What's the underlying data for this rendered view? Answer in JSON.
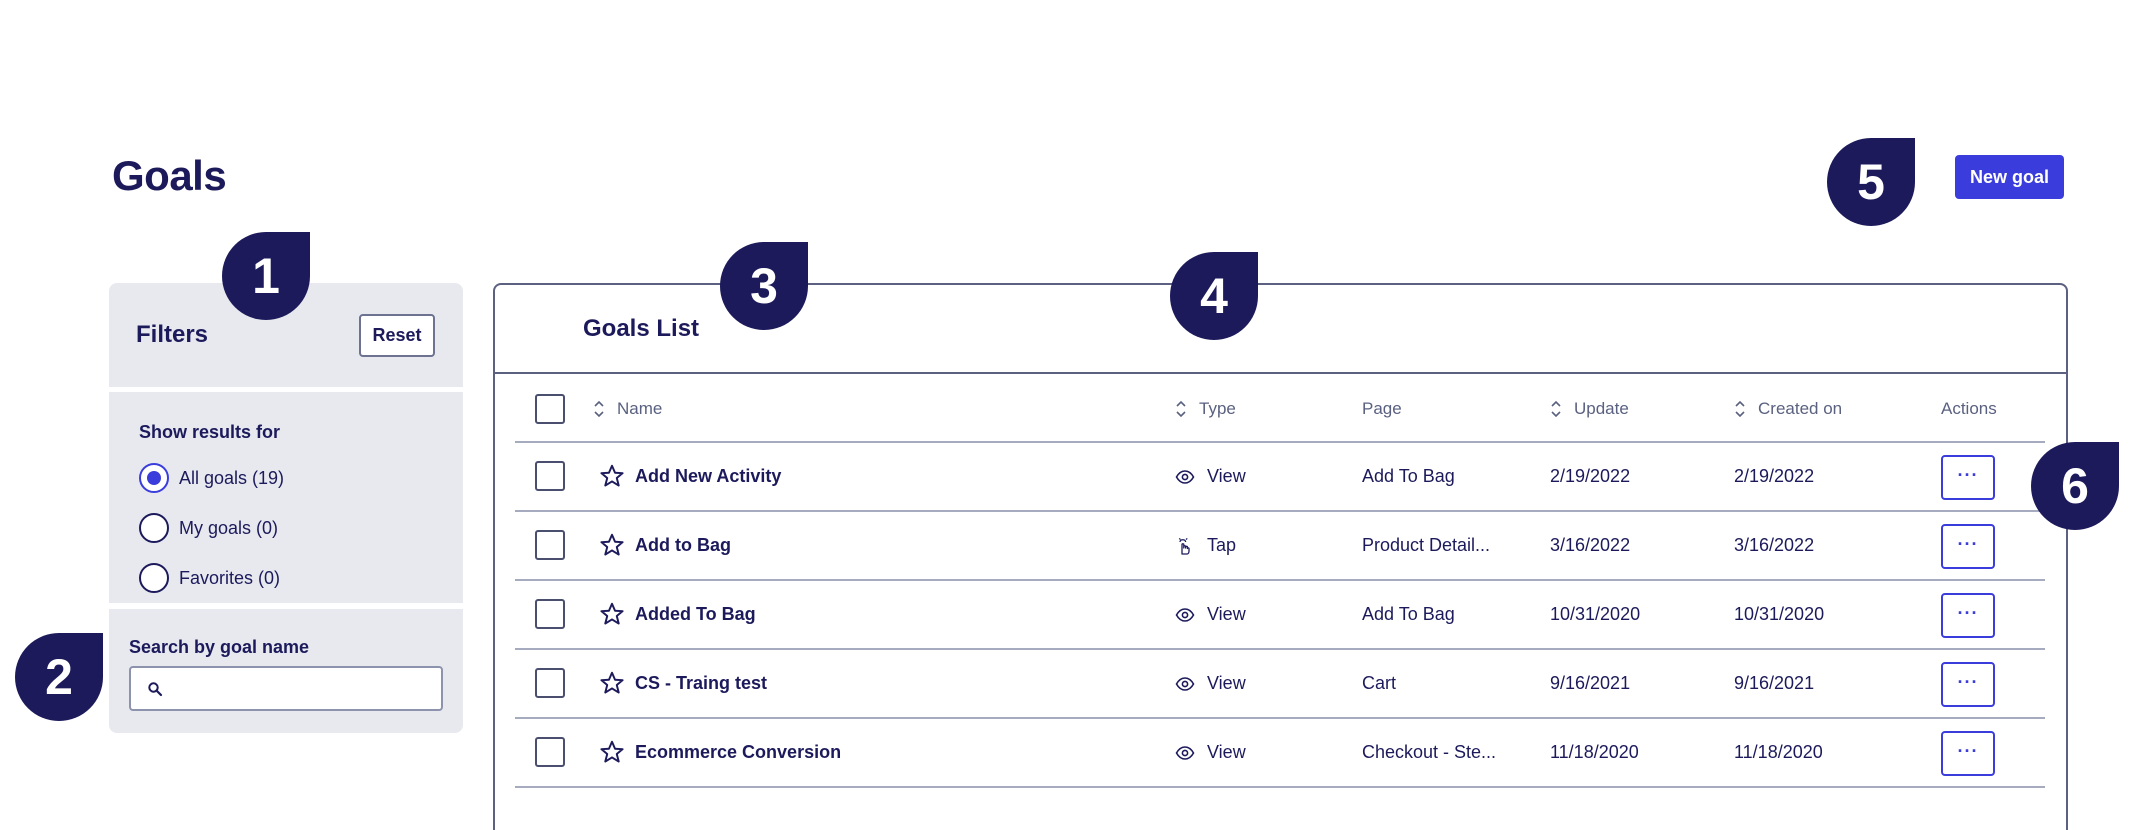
{
  "page": {
    "title": "Goals",
    "new_goal_label": "New goal"
  },
  "filters": {
    "title": "Filters",
    "reset_label": "Reset",
    "show_results_label": "Show results for",
    "options": [
      {
        "label": "All goals (19)",
        "checked": true
      },
      {
        "label": "My goals (0)",
        "checked": false
      },
      {
        "label": "Favorites (0)",
        "checked": false
      }
    ],
    "search_label": "Search by goal name",
    "search_value": ""
  },
  "goals_list": {
    "title": "Goals List",
    "columns": {
      "name": "Name",
      "type": "Type",
      "page": "Page",
      "update": "Update",
      "created": "Created on",
      "actions": "Actions"
    },
    "rows": [
      {
        "name": "Add New Activity",
        "type": "View",
        "type_icon": "eye-icon",
        "page": "Add To Bag",
        "update": "2/19/2022",
        "created": "2/19/2022"
      },
      {
        "name": "Add to Bag",
        "type": "Tap",
        "type_icon": "tap-icon",
        "page": "Product Detail...",
        "update": "3/16/2022",
        "created": "3/16/2022"
      },
      {
        "name": "Added To Bag",
        "type": "View",
        "type_icon": "eye-icon",
        "page": "Add To Bag",
        "update": "10/31/2020",
        "created": "10/31/2020"
      },
      {
        "name": "CS - Traing test",
        "type": "View",
        "type_icon": "eye-icon",
        "page": "Cart",
        "update": "9/16/2021",
        "created": "9/16/2021"
      },
      {
        "name": "Ecommerce Conversion",
        "type": "View",
        "type_icon": "eye-icon",
        "page": "Checkout - Ste...",
        "update": "11/18/2020",
        "created": "11/18/2020"
      }
    ],
    "actions_glyph": "···"
  },
  "callouts": [
    "1",
    "2",
    "3",
    "4",
    "5",
    "6"
  ],
  "colors": {
    "primary": "#3a3ddb",
    "navy": "#1c1a5b",
    "panel": "#e7e9ef",
    "border": "#5c6182"
  }
}
